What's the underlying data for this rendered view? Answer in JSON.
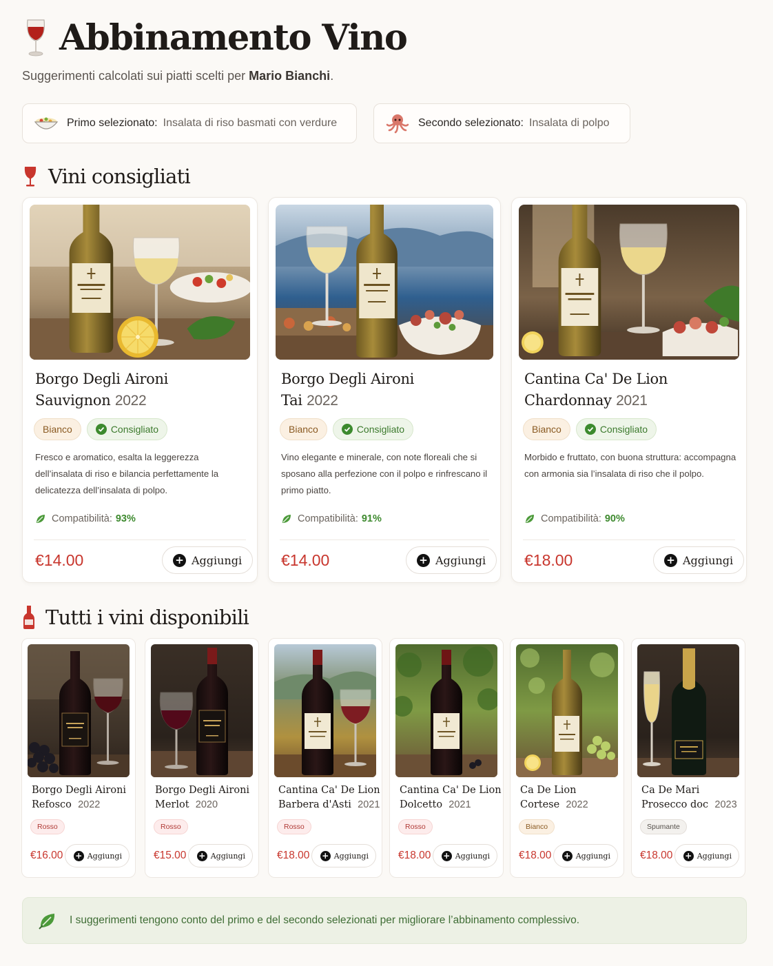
{
  "header": {
    "title": "Abbinamento Vino",
    "subtitle_prefix": "Suggerimenti calcolati sui piatti scelti per ",
    "user_name": "Mario Bianchi",
    "subtitle_suffix": "."
  },
  "selection": {
    "primo": {
      "label": "Primo selezionato:",
      "value": "Insalata di riso basmati con verdure",
      "icon": "rice-salad-icon"
    },
    "secondo": {
      "label": "Secondo selezionato:",
      "value": "Insalata di polpo",
      "icon": "octopus-icon"
    }
  },
  "recommended": {
    "title": "Vini consigliati",
    "compat_label": "Compatibilità:",
    "add_label": "Aggiungi",
    "items": [
      {
        "name_line1": "Borgo Degli Aironi",
        "name_line2": "Sauvignon",
        "year": "2022",
        "type": "Bianco",
        "badge": "Consigliato",
        "description": "Fresco e aromatico, esalta la leggerezza dell’insalata di riso e bilancia perfettamente la delicatezza dell’insalata di polpo.",
        "compatibility": "93%",
        "price": "€14.00"
      },
      {
        "name_line1": "Borgo Degli Aironi",
        "name_line2": "Tai",
        "year": "2022",
        "type": "Bianco",
        "badge": "Consigliato",
        "description": "Vino elegante e minerale, con note floreali che si sposano alla perfezione con il polpo e rinfrescano il primo piatto.",
        "compatibility": "91%",
        "price": "€14.00"
      },
      {
        "name_line1": "Cantina Ca' De Lion",
        "name_line2": "Chardonnay",
        "year": "2021",
        "type": "Bianco",
        "badge": "Consigliato",
        "description": "Morbido e fruttato, con buona struttura: accompagna con armonia sia l’insalata di riso che il polpo.",
        "compatibility": "90%",
        "price": "€18.00"
      }
    ]
  },
  "all_wines": {
    "title": "Tutti i vini disponibili",
    "add_label": "Aggiungi",
    "items": [
      {
        "name_line1": "Borgo Degli Aironi",
        "name_line2": "Refosco",
        "year": "2022",
        "type": "Rosso",
        "price": "€16.00"
      },
      {
        "name_line1": "Borgo Degli Aironi",
        "name_line2": "Merlot",
        "year": "2020",
        "type": "Rosso",
        "price": "€15.00"
      },
      {
        "name_line1": "Cantina Ca' De Lion",
        "name_line2": "Barbera d'Asti",
        "year": "2021",
        "type": "Rosso",
        "price": "€18.00"
      },
      {
        "name_line1": "Cantina Ca' De Lion",
        "name_line2": "Dolcetto",
        "year": "2021",
        "type": "Rosso",
        "price": "€18.00"
      },
      {
        "name_line1": "Ca De Lion",
        "name_line2": "Cortese",
        "year": "2022",
        "type": "Bianco",
        "price": "€18.00"
      },
      {
        "name_line1": "Ca De Mari",
        "name_line2": "Prosecco doc",
        "year": "2023",
        "type": "Spumante",
        "price": "€18.00"
      }
    ]
  },
  "footer_note": "I suggerimenti tengono conto del primo e del secondo selezionati per migliorare l’abbinamento complessivo.",
  "colors": {
    "price_red": "#c8362d",
    "compat_green": "#3e8a2f",
    "note_bg": "#edf1e5",
    "page_bg": "#fbf9f6"
  }
}
